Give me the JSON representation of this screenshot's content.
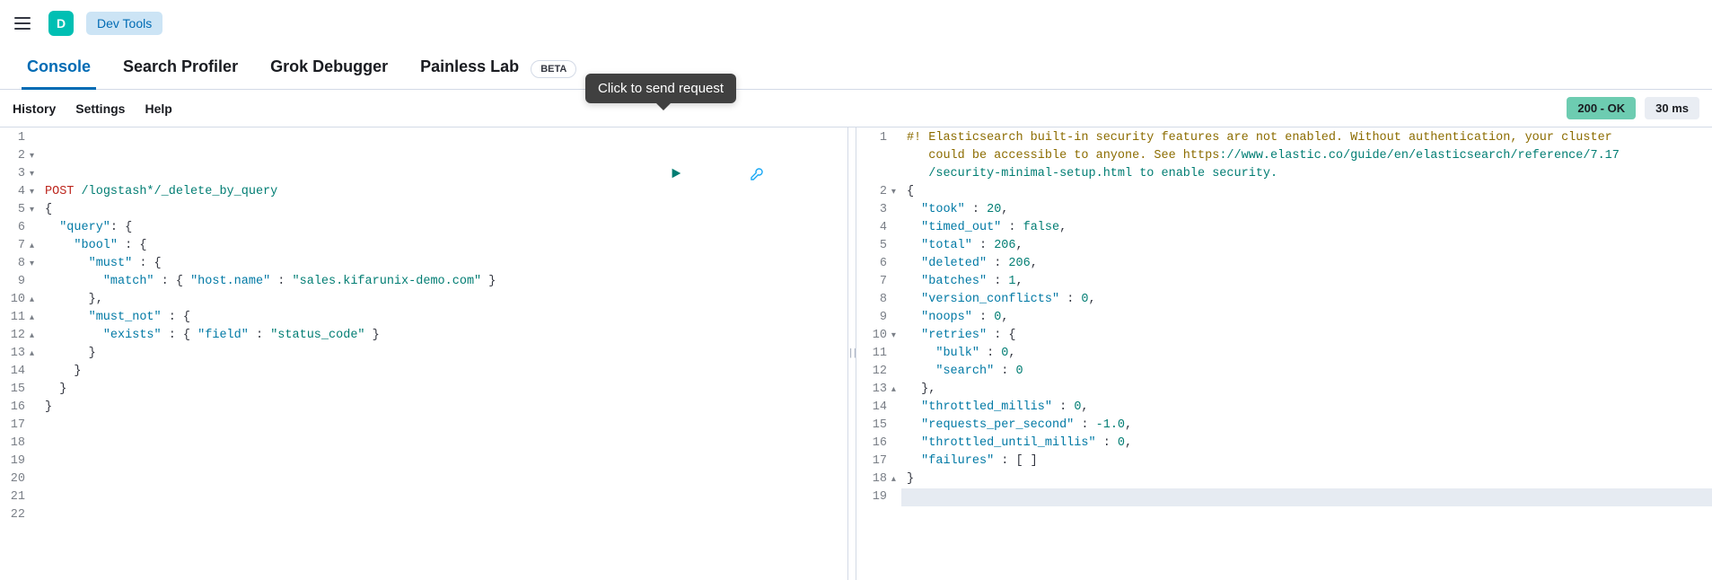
{
  "header": {
    "app_letter": "D",
    "app_badge": "Dev Tools"
  },
  "tabs": [
    {
      "label": "Console",
      "active": true
    },
    {
      "label": "Search Profiler"
    },
    {
      "label": "Grok Debugger"
    },
    {
      "label": "Painless Lab",
      "beta": true,
      "beta_label": "BETA"
    }
  ],
  "menu": {
    "history": "History",
    "settings": "Settings",
    "help": "Help"
  },
  "status": {
    "ok": "200 - OK",
    "time": "30 ms"
  },
  "tooltip": "Click to send request",
  "request": {
    "method": "POST",
    "path": "/logstash*/_delete_by_query",
    "lines_raw": [
      "{",
      "  \"query\": {",
      "    \"bool\" : {",
      "      \"must\" : {",
      "        \"match\" : { \"host.name\" : \"sales.kifarunix-demo.com\" }",
      "      },",
      "      \"must_not\" : {",
      "        \"exists\" : { \"field\" : \"status_code\" }",
      "      }",
      "    }",
      "  }",
      "}"
    ],
    "gutter": [
      "1",
      "2",
      "3",
      "4",
      "5",
      "6",
      "7",
      "8",
      "9",
      "10",
      "11",
      "12",
      "13",
      "14",
      "15",
      "16",
      "17",
      "18",
      "19",
      "20",
      "21",
      "22"
    ],
    "folds": {
      "2": "▼",
      "3": "▼",
      "4": "▼",
      "5": "▼",
      "7": "▲",
      "8": "▼",
      "10": "▲",
      "11": "▲",
      "12": "▲",
      "13": "▲"
    }
  },
  "response": {
    "warning_l1": "#! Elasticsearch built-in security features are not enabled. Without authentication, your cluster",
    "warning_l1b": "   could be accessible to anyone. See https://www.elastic.co/guide/en/elasticsearch/reference/7.17",
    "warning_l1c": "   /security-minimal-setup.html to enable security.",
    "gutter": [
      "1",
      "",
      "",
      "2",
      "3",
      "4",
      "5",
      "6",
      "7",
      "8",
      "9",
      "10",
      "11",
      "12",
      "13",
      "14",
      "15",
      "16",
      "17",
      "18",
      "19"
    ],
    "folds": {
      "2": "▼",
      "10": "▼",
      "13": "▲",
      "18": "▲"
    },
    "body": {
      "took": 20,
      "timed_out": false,
      "total": 206,
      "deleted": 206,
      "batches": 1,
      "version_conflicts": 0,
      "noops": 0,
      "retries": {
        "bulk": 0,
        "search": 0
      },
      "throttled_millis": 0,
      "requests_per_second": -1.0,
      "throttled_until_millis": 0,
      "failures": "[ ]"
    }
  }
}
